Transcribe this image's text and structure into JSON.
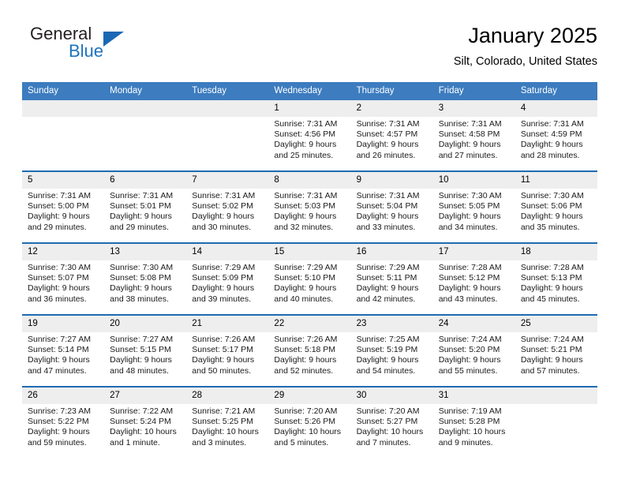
{
  "brand": {
    "name_top": "General",
    "name_bottom": "Blue",
    "color_blue": "#1f72bd",
    "color_dark": "#231f20"
  },
  "header": {
    "title": "January 2025",
    "subtitle": "Silt, Colorado, United States"
  },
  "theme": {
    "header_bg": "#3c7cbf",
    "row_rule": "#1f6cb0",
    "daynum_bg": "#eeeeee"
  },
  "weekday_headers": [
    "Sunday",
    "Monday",
    "Tuesday",
    "Wednesday",
    "Thursday",
    "Friday",
    "Saturday"
  ],
  "weeks": [
    [
      {
        "day": "",
        "sunrise": "",
        "sunset": "",
        "daylight": ""
      },
      {
        "day": "",
        "sunrise": "",
        "sunset": "",
        "daylight": ""
      },
      {
        "day": "",
        "sunrise": "",
        "sunset": "",
        "daylight": ""
      },
      {
        "day": "1",
        "sunrise": "Sunrise: 7:31 AM",
        "sunset": "Sunset: 4:56 PM",
        "daylight": "Daylight: 9 hours and 25 minutes."
      },
      {
        "day": "2",
        "sunrise": "Sunrise: 7:31 AM",
        "sunset": "Sunset: 4:57 PM",
        "daylight": "Daylight: 9 hours and 26 minutes."
      },
      {
        "day": "3",
        "sunrise": "Sunrise: 7:31 AM",
        "sunset": "Sunset: 4:58 PM",
        "daylight": "Daylight: 9 hours and 27 minutes."
      },
      {
        "day": "4",
        "sunrise": "Sunrise: 7:31 AM",
        "sunset": "Sunset: 4:59 PM",
        "daylight": "Daylight: 9 hours and 28 minutes."
      }
    ],
    [
      {
        "day": "5",
        "sunrise": "Sunrise: 7:31 AM",
        "sunset": "Sunset: 5:00 PM",
        "daylight": "Daylight: 9 hours and 29 minutes."
      },
      {
        "day": "6",
        "sunrise": "Sunrise: 7:31 AM",
        "sunset": "Sunset: 5:01 PM",
        "daylight": "Daylight: 9 hours and 29 minutes."
      },
      {
        "day": "7",
        "sunrise": "Sunrise: 7:31 AM",
        "sunset": "Sunset: 5:02 PM",
        "daylight": "Daylight: 9 hours and 30 minutes."
      },
      {
        "day": "8",
        "sunrise": "Sunrise: 7:31 AM",
        "sunset": "Sunset: 5:03 PM",
        "daylight": "Daylight: 9 hours and 32 minutes."
      },
      {
        "day": "9",
        "sunrise": "Sunrise: 7:31 AM",
        "sunset": "Sunset: 5:04 PM",
        "daylight": "Daylight: 9 hours and 33 minutes."
      },
      {
        "day": "10",
        "sunrise": "Sunrise: 7:30 AM",
        "sunset": "Sunset: 5:05 PM",
        "daylight": "Daylight: 9 hours and 34 minutes."
      },
      {
        "day": "11",
        "sunrise": "Sunrise: 7:30 AM",
        "sunset": "Sunset: 5:06 PM",
        "daylight": "Daylight: 9 hours and 35 minutes."
      }
    ],
    [
      {
        "day": "12",
        "sunrise": "Sunrise: 7:30 AM",
        "sunset": "Sunset: 5:07 PM",
        "daylight": "Daylight: 9 hours and 36 minutes."
      },
      {
        "day": "13",
        "sunrise": "Sunrise: 7:30 AM",
        "sunset": "Sunset: 5:08 PM",
        "daylight": "Daylight: 9 hours and 38 minutes."
      },
      {
        "day": "14",
        "sunrise": "Sunrise: 7:29 AM",
        "sunset": "Sunset: 5:09 PM",
        "daylight": "Daylight: 9 hours and 39 minutes."
      },
      {
        "day": "15",
        "sunrise": "Sunrise: 7:29 AM",
        "sunset": "Sunset: 5:10 PM",
        "daylight": "Daylight: 9 hours and 40 minutes."
      },
      {
        "day": "16",
        "sunrise": "Sunrise: 7:29 AM",
        "sunset": "Sunset: 5:11 PM",
        "daylight": "Daylight: 9 hours and 42 minutes."
      },
      {
        "day": "17",
        "sunrise": "Sunrise: 7:28 AM",
        "sunset": "Sunset: 5:12 PM",
        "daylight": "Daylight: 9 hours and 43 minutes."
      },
      {
        "day": "18",
        "sunrise": "Sunrise: 7:28 AM",
        "sunset": "Sunset: 5:13 PM",
        "daylight": "Daylight: 9 hours and 45 minutes."
      }
    ],
    [
      {
        "day": "19",
        "sunrise": "Sunrise: 7:27 AM",
        "sunset": "Sunset: 5:14 PM",
        "daylight": "Daylight: 9 hours and 47 minutes."
      },
      {
        "day": "20",
        "sunrise": "Sunrise: 7:27 AM",
        "sunset": "Sunset: 5:15 PM",
        "daylight": "Daylight: 9 hours and 48 minutes."
      },
      {
        "day": "21",
        "sunrise": "Sunrise: 7:26 AM",
        "sunset": "Sunset: 5:17 PM",
        "daylight": "Daylight: 9 hours and 50 minutes."
      },
      {
        "day": "22",
        "sunrise": "Sunrise: 7:26 AM",
        "sunset": "Sunset: 5:18 PM",
        "daylight": "Daylight: 9 hours and 52 minutes."
      },
      {
        "day": "23",
        "sunrise": "Sunrise: 7:25 AM",
        "sunset": "Sunset: 5:19 PM",
        "daylight": "Daylight: 9 hours and 54 minutes."
      },
      {
        "day": "24",
        "sunrise": "Sunrise: 7:24 AM",
        "sunset": "Sunset: 5:20 PM",
        "daylight": "Daylight: 9 hours and 55 minutes."
      },
      {
        "day": "25",
        "sunrise": "Sunrise: 7:24 AM",
        "sunset": "Sunset: 5:21 PM",
        "daylight": "Daylight: 9 hours and 57 minutes."
      }
    ],
    [
      {
        "day": "26",
        "sunrise": "Sunrise: 7:23 AM",
        "sunset": "Sunset: 5:22 PM",
        "daylight": "Daylight: 9 hours and 59 minutes."
      },
      {
        "day": "27",
        "sunrise": "Sunrise: 7:22 AM",
        "sunset": "Sunset: 5:24 PM",
        "daylight": "Daylight: 10 hours and 1 minute."
      },
      {
        "day": "28",
        "sunrise": "Sunrise: 7:21 AM",
        "sunset": "Sunset: 5:25 PM",
        "daylight": "Daylight: 10 hours and 3 minutes."
      },
      {
        "day": "29",
        "sunrise": "Sunrise: 7:20 AM",
        "sunset": "Sunset: 5:26 PM",
        "daylight": "Daylight: 10 hours and 5 minutes."
      },
      {
        "day": "30",
        "sunrise": "Sunrise: 7:20 AM",
        "sunset": "Sunset: 5:27 PM",
        "daylight": "Daylight: 10 hours and 7 minutes."
      },
      {
        "day": "31",
        "sunrise": "Sunrise: 7:19 AM",
        "sunset": "Sunset: 5:28 PM",
        "daylight": "Daylight: 10 hours and 9 minutes."
      },
      {
        "day": "",
        "sunrise": "",
        "sunset": "",
        "daylight": ""
      }
    ]
  ]
}
